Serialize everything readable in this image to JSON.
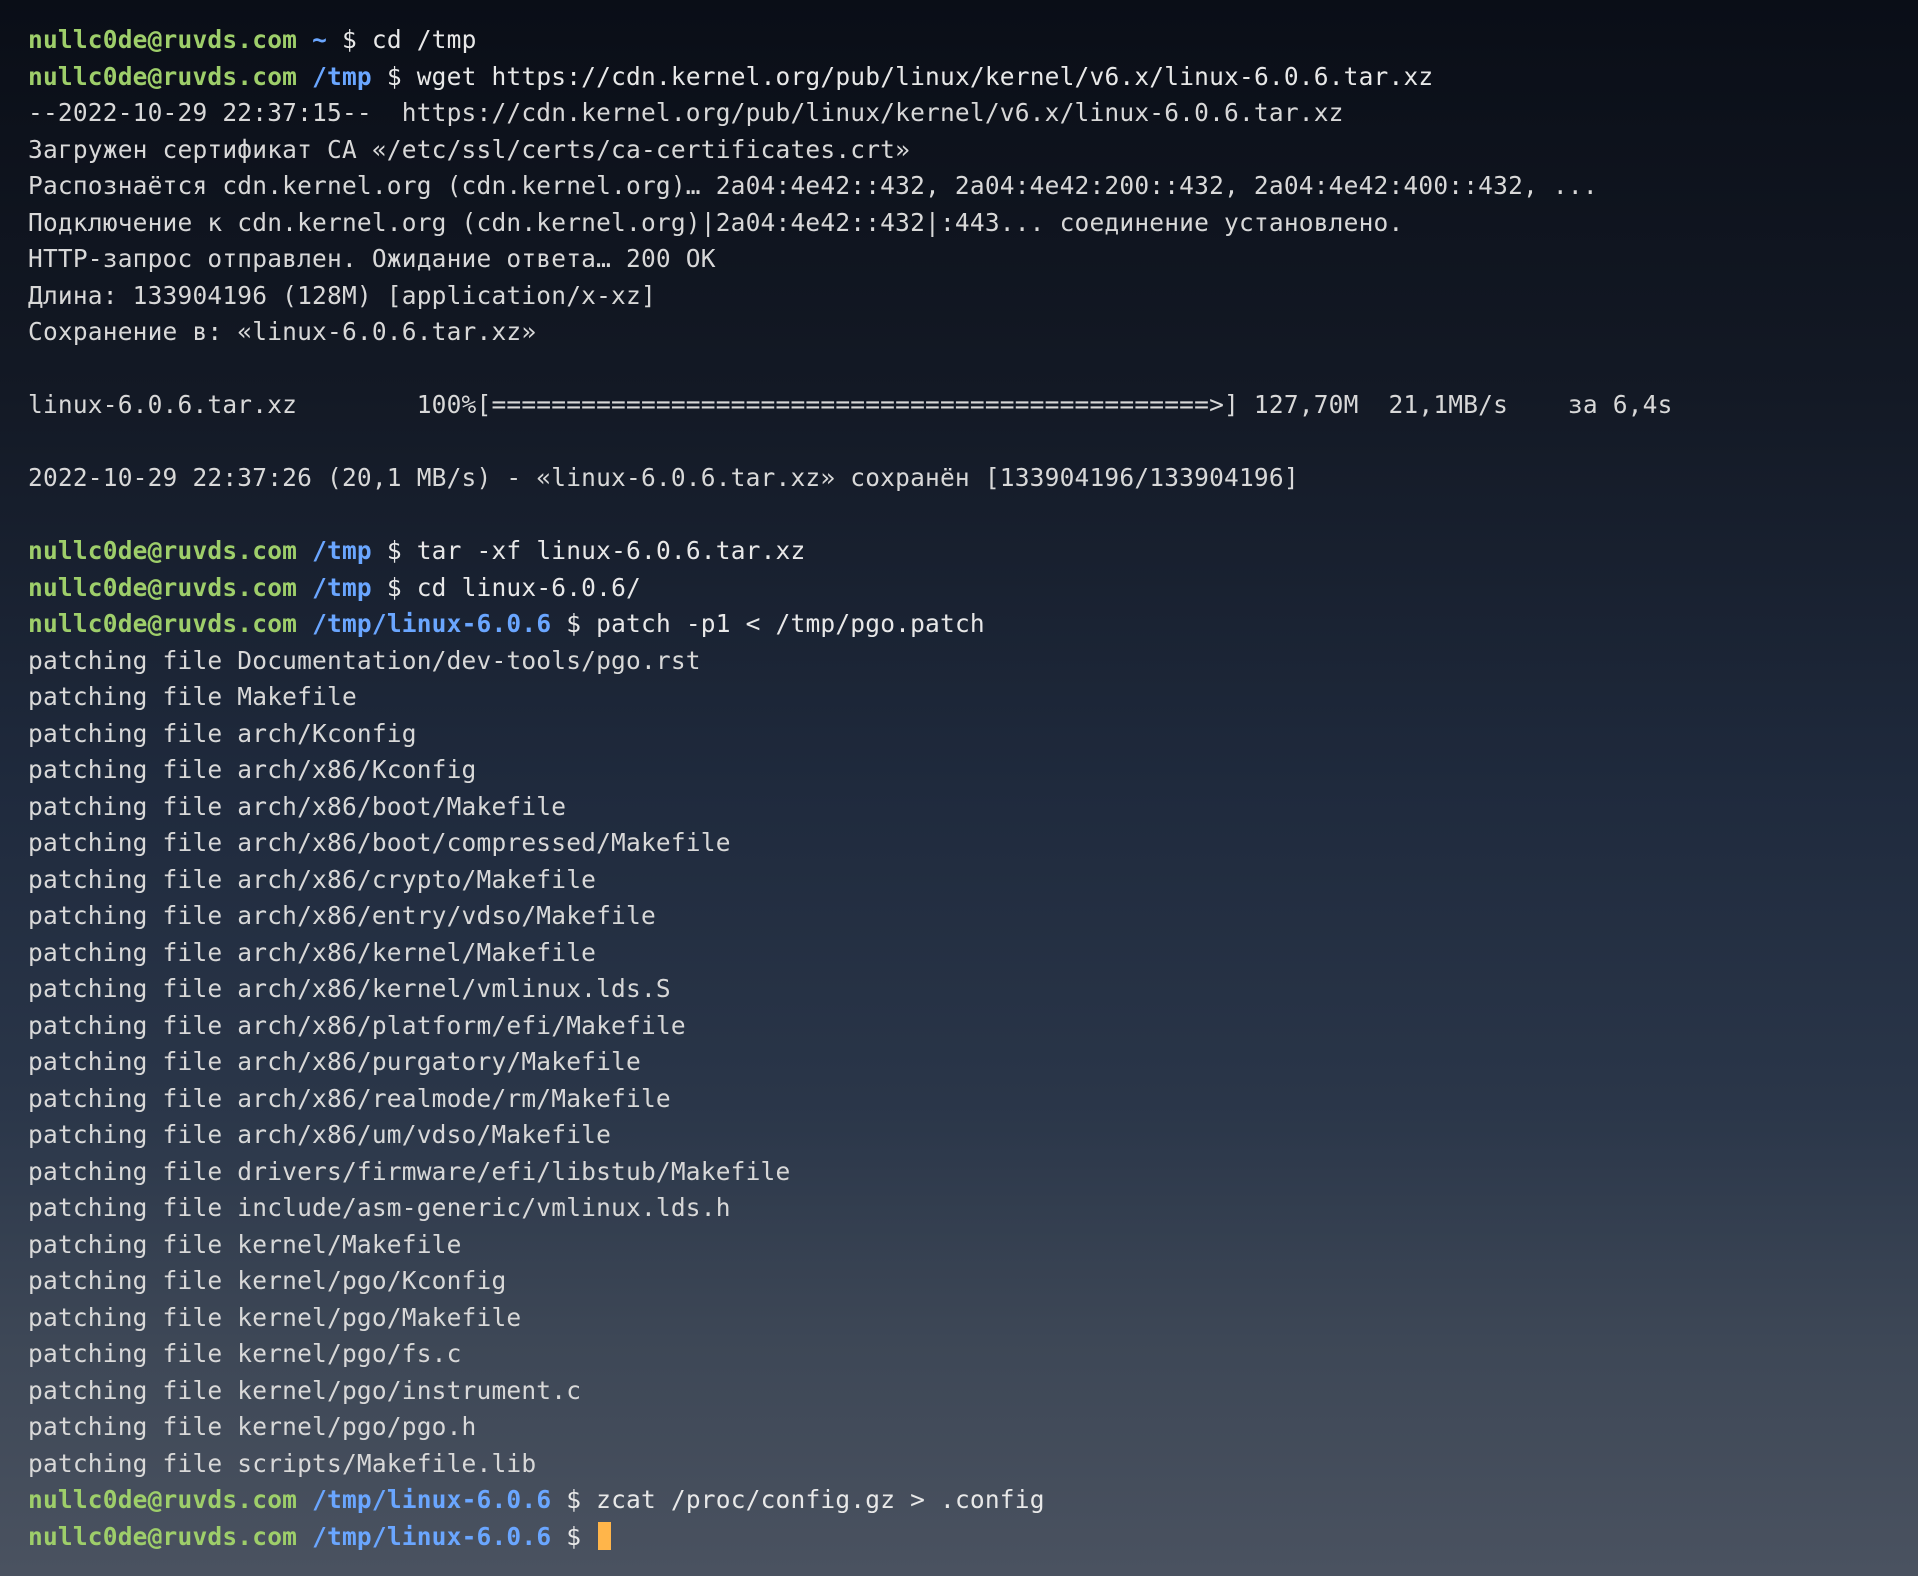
{
  "prompts": [
    {
      "user": "nullc0de@ruvds.com",
      "path": "~",
      "cmd": "cd /tmp"
    },
    {
      "user": "nullc0de@ruvds.com",
      "path": "/tmp",
      "cmd": "wget https://cdn.kernel.org/pub/linux/kernel/v6.x/linux-6.0.6.tar.xz"
    },
    {
      "user": "nullc0de@ruvds.com",
      "path": "/tmp",
      "cmd": "tar -xf linux-6.0.6.tar.xz"
    },
    {
      "user": "nullc0de@ruvds.com",
      "path": "/tmp",
      "cmd": "cd linux-6.0.6/"
    },
    {
      "user": "nullc0de@ruvds.com",
      "path": "/tmp/linux-6.0.6",
      "cmd": "patch -p1 < /tmp/pgo.patch"
    },
    {
      "user": "nullc0de@ruvds.com",
      "path": "/tmp/linux-6.0.6",
      "cmd": "zcat /proc/config.gz > .config"
    },
    {
      "user": "nullc0de@ruvds.com",
      "path": "/tmp/linux-6.0.6",
      "cmd": ""
    }
  ],
  "wget_output": [
    "--2022-10-29 22:37:15--  https://cdn.kernel.org/pub/linux/kernel/v6.x/linux-6.0.6.tar.xz",
    "Загружен сертификат CA «/etc/ssl/certs/ca-certificates.crt»",
    "Распознаётся cdn.kernel.org (cdn.kernel.org)… 2a04:4e42::432, 2a04:4e42:200::432, 2a04:4e42:400::432, ...",
    "Подключение к cdn.kernel.org (cdn.kernel.org)|2a04:4e42::432|:443... соединение установлено.",
    "HTTP-запрос отправлен. Ожидание ответа… 200 OK",
    "Длина: 133904196 (128M) [application/x-xz]",
    "Сохранение в: «linux-6.0.6.tar.xz»",
    "",
    "linux-6.0.6.tar.xz        100%[================================================>] 127,70M  21,1MB/s    за 6,4s",
    "",
    "2022-10-29 22:37:26 (20,1 MB/s) - «linux-6.0.6.tar.xz» сохранён [133904196/133904196]",
    ""
  ],
  "patch_output": [
    "patching file Documentation/dev-tools/pgo.rst",
    "patching file Makefile",
    "patching file arch/Kconfig",
    "patching file arch/x86/Kconfig",
    "patching file arch/x86/boot/Makefile",
    "patching file arch/x86/boot/compressed/Makefile",
    "patching file arch/x86/crypto/Makefile",
    "patching file arch/x86/entry/vdso/Makefile",
    "patching file arch/x86/kernel/Makefile",
    "patching file arch/x86/kernel/vmlinux.lds.S",
    "patching file arch/x86/platform/efi/Makefile",
    "patching file arch/x86/purgatory/Makefile",
    "patching file arch/x86/realmode/rm/Makefile",
    "patching file arch/x86/um/vdso/Makefile",
    "patching file drivers/firmware/efi/libstub/Makefile",
    "patching file include/asm-generic/vmlinux.lds.h",
    "patching file kernel/Makefile",
    "patching file kernel/pgo/Kconfig",
    "patching file kernel/pgo/Makefile",
    "patching file kernel/pgo/fs.c",
    "patching file kernel/pgo/instrument.c",
    "patching file kernel/pgo/pgo.h",
    "patching file scripts/Makefile.lib"
  ]
}
